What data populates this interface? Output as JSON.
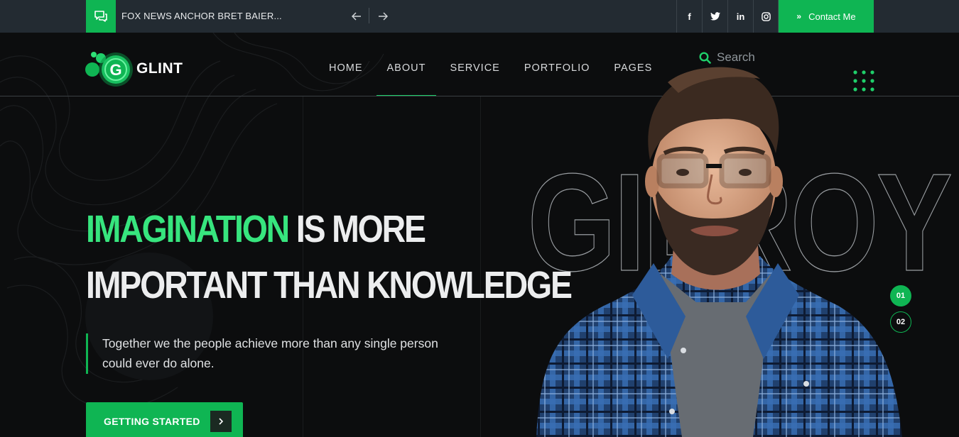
{
  "topbar": {
    "news_headline": "FOX NEWS ANCHOR BRET BAIER...",
    "socials": [
      "f",
      "twitter",
      "in",
      "instagram"
    ],
    "contact_label": "Contact Me"
  },
  "header": {
    "logo_letter": "G",
    "logo_text": "GLINT",
    "nav": [
      "HOME",
      "ABOUT",
      "SERVICE",
      "PORTFOLIO",
      "PAGES"
    ],
    "active_nav": "ABOUT",
    "search_placeholder": "Search"
  },
  "hero": {
    "title_accent": "IMAGINATION",
    "title_rest_line1": " IS MORE",
    "title_line2": "IMPORTANT THAN KNOWLEDGE",
    "subtitle": "Together we the people achieve more than any single person could ever do alone.",
    "cta_label": "GETTING STARTED",
    "outline_word": "GILROY",
    "slides": [
      "01",
      "02"
    ]
  },
  "colors": {
    "accent": "#0fb553",
    "accent_light": "#37e57e",
    "topbar_bg": "#232b32",
    "page_bg": "#0c0d0e"
  }
}
